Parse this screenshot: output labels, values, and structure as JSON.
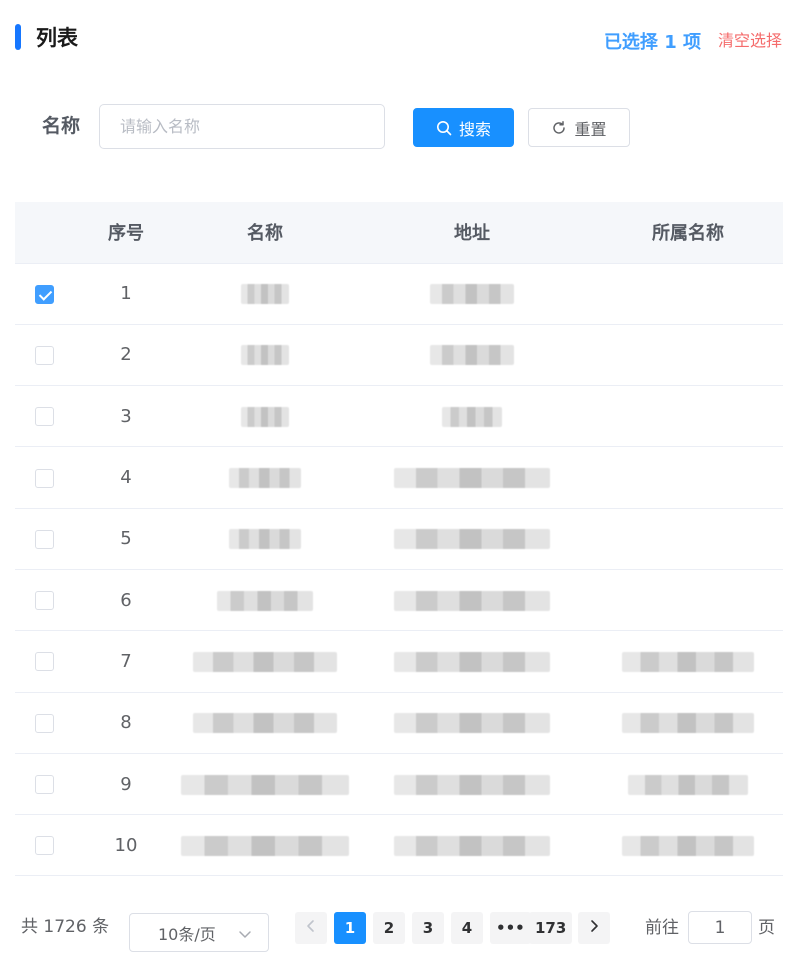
{
  "header": {
    "title": "列表",
    "selected_text": "已选择 1 项",
    "clear_label": "清空选择"
  },
  "filter": {
    "name_label": "名称",
    "name_placeholder": "请输入名称",
    "name_value": "",
    "search_label": "搜索",
    "reset_label": "重置"
  },
  "table": {
    "columns": [
      "序号",
      "名称",
      "地址",
      "所属名称"
    ],
    "rows": [
      {
        "index": "1",
        "checked": true
      },
      {
        "index": "2",
        "checked": false
      },
      {
        "index": "3",
        "checked": false
      },
      {
        "index": "4",
        "checked": false
      },
      {
        "index": "5",
        "checked": false
      },
      {
        "index": "6",
        "checked": false
      },
      {
        "index": "7",
        "checked": false
      },
      {
        "index": "8",
        "checked": false
      },
      {
        "index": "9",
        "checked": false
      },
      {
        "index": "10",
        "checked": false
      }
    ]
  },
  "pagination": {
    "total_text": "共 1726 条",
    "page_size": "10条/页",
    "pages": [
      "1",
      "2",
      "3",
      "4",
      "•••",
      "173"
    ],
    "current_page": "1",
    "goto_label": "前往",
    "goto_value": "1",
    "page_unit": "页"
  },
  "colors": {
    "primary": "#1890ff",
    "selected_text": "#409eff",
    "danger": "#f56c6c"
  },
  "icons": {
    "search": "search-icon",
    "reset": "refresh-icon",
    "prev": "chevron-left-icon",
    "next": "chevron-right-icon",
    "dropdown": "chevron-down-icon"
  }
}
